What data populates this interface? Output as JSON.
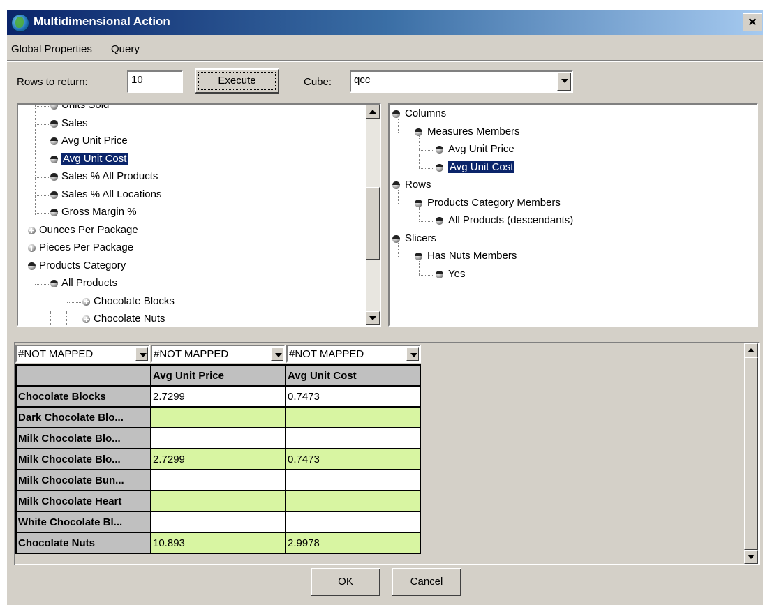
{
  "window": {
    "title": "Multidimensional Action",
    "close": "×"
  },
  "menu": [
    "Global Properties",
    "Query"
  ],
  "toolbar": {
    "rows_label": "Rows to return:",
    "rows_value": "10",
    "execute_label": "Execute",
    "cube_label": "Cube:",
    "cube_value": "qcc"
  },
  "left_tree": [
    {
      "label": "Units Sold",
      "level": 2,
      "selected": false,
      "node": "leaf"
    },
    {
      "label": "Sales",
      "level": 2,
      "selected": false,
      "node": "leaf"
    },
    {
      "label": "Avg Unit Price",
      "level": 2,
      "selected": false,
      "node": "leaf"
    },
    {
      "label": "Avg Unit Cost",
      "level": 2,
      "selected": true,
      "node": "leaf"
    },
    {
      "label": "Sales % All Products",
      "level": 2,
      "selected": false,
      "node": "leaf"
    },
    {
      "label": "Sales % All Locations",
      "level": 2,
      "selected": false,
      "node": "leaf"
    },
    {
      "label": "Gross Margin %",
      "level": 2,
      "selected": false,
      "node": "leaf"
    },
    {
      "label": "Ounces Per Package",
      "level": 1,
      "selected": false,
      "node": "collapsed"
    },
    {
      "label": "Pieces Per Package",
      "level": 1,
      "selected": false,
      "node": "collapsed"
    },
    {
      "label": "Products Category",
      "level": 1,
      "selected": false,
      "node": "expanded"
    },
    {
      "label": "All Products",
      "level": 2,
      "selected": false,
      "node": "expanded"
    },
    {
      "label": "Chocolate Blocks",
      "level": 3,
      "selected": false,
      "node": "collapsed"
    },
    {
      "label": "Chocolate Nuts",
      "level": 3,
      "selected": false,
      "node": "collapsed"
    }
  ],
  "right_tree": [
    {
      "label": "Columns",
      "level": 1,
      "selected": false
    },
    {
      "label": "Measures Members",
      "level": 2,
      "selected": false
    },
    {
      "label": "Avg Unit Price",
      "level": 3,
      "selected": false
    },
    {
      "label": "Avg Unit Cost",
      "level": 3,
      "selected": true
    },
    {
      "label": "Rows",
      "level": 1,
      "selected": false
    },
    {
      "label": "Products Category Members",
      "level": 2,
      "selected": false
    },
    {
      "label": "All Products (descendants)",
      "level": 3,
      "selected": false
    },
    {
      "label": "Slicers",
      "level": 1,
      "selected": false
    },
    {
      "label": "Has Nuts Members",
      "level": 2,
      "selected": false
    },
    {
      "label": "Yes",
      "level": 3,
      "selected": false
    }
  ],
  "grid": {
    "mappings": [
      "#NOT MAPPED",
      "#NOT MAPPED",
      "#NOT MAPPED"
    ],
    "columns": [
      "Avg Unit Price",
      "Avg Unit Cost"
    ],
    "rows": [
      {
        "label": "Chocolate Blocks",
        "values": [
          "2.7299",
          "0.7473"
        ],
        "shade": "#ffffff"
      },
      {
        "label": "Dark Chocolate Blo...",
        "values": [
          "",
          ""
        ],
        "shade": "#d8f5a2"
      },
      {
        "label": "Milk Chocolate Blo...",
        "values": [
          "",
          ""
        ],
        "shade": "#ffffff"
      },
      {
        "label": "Milk Chocolate Blo...",
        "values": [
          "2.7299",
          "0.7473"
        ],
        "shade": "#d8f5a2"
      },
      {
        "label": "Milk Chocolate Bun...",
        "values": [
          "",
          ""
        ],
        "shade": "#ffffff"
      },
      {
        "label": "Milk Chocolate Heart",
        "values": [
          "",
          ""
        ],
        "shade": "#d8f5a2"
      },
      {
        "label": "White Chocolate Bl...",
        "values": [
          "",
          ""
        ],
        "shade": "#ffffff"
      },
      {
        "label": "Chocolate Nuts",
        "values": [
          "10.893",
          "2.9978"
        ],
        "shade": "#d8f5a2"
      }
    ]
  },
  "footer": {
    "ok_label": "OK",
    "cancel_label": "Cancel"
  }
}
